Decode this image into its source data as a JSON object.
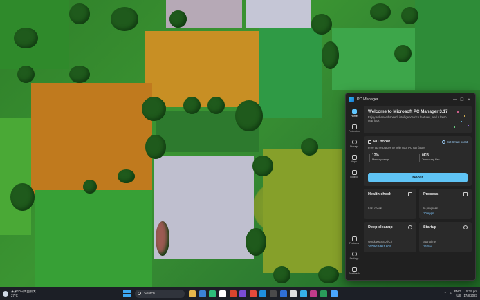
{
  "window": {
    "title": "PC Manager",
    "controls": [
      "—",
      "☐",
      "✕"
    ]
  },
  "sidebar": {
    "items": [
      {
        "label": "Home",
        "icon": "home-icon"
      },
      {
        "label": "Protection",
        "icon": "shield-icon"
      },
      {
        "label": "Storage",
        "icon": "storage-icon"
      },
      {
        "label": "Apps",
        "icon": "apps-icon"
      },
      {
        "label": "Toolbox",
        "icon": "toolbox-icon"
      }
    ],
    "bottom_items": [
      {
        "label": "Features",
        "icon": "features-icon"
      },
      {
        "label": "Settings",
        "icon": "settings-icon"
      },
      {
        "label": "Feedback",
        "icon": "feedback-icon"
      }
    ]
  },
  "welcome": {
    "title": "Welcome to Microsoft PC Manager 3.17",
    "subtitle": "Enjoy enhanced speed, intelligence-rich features, and a fresh new look"
  },
  "boost": {
    "title": "PC boost",
    "smart_boost": "Set Smart boost",
    "subtitle": "Free up resources to help your PC run faster",
    "memory_value": "12%",
    "memory_label": "Memory usage",
    "temp_value": "0KB",
    "temp_label": "Temporary files",
    "button": "Boost"
  },
  "tiles": {
    "health": {
      "title": "Health check",
      "line1": "Last check",
      "line2": ""
    },
    "process": {
      "title": "Process",
      "line1": "In progress",
      "line2": "10 Apps"
    },
    "cleanup": {
      "title": "Deep cleanup",
      "line1": "Windows SSD (C:)",
      "line2": "367.9GB/951.6GB"
    },
    "startup": {
      "title": "Startup",
      "line1": "Start time",
      "line2": "16 Sec"
    }
  },
  "taskbar": {
    "weather_line1": "未来10日大面积大",
    "weather_line2": "27°C",
    "search_placeholder": "Search",
    "clock_time": "5:19 pm",
    "clock_date": "17/8/2023",
    "tray_lang": "ENG",
    "tray_region": "US"
  },
  "colors": {
    "accent": "#5fc4f5",
    "window_bg": "#202020",
    "card_bg": "#2a2a2a",
    "taskbar_bg": "#1c1f26"
  }
}
